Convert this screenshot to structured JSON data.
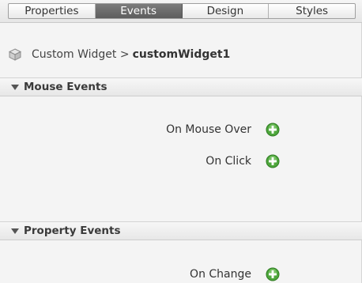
{
  "tabs": [
    {
      "label": "Properties",
      "active": false
    },
    {
      "label": "Events",
      "active": true
    },
    {
      "label": "Design",
      "active": false
    },
    {
      "label": "Styles",
      "active": false
    }
  ],
  "breadcrumb": {
    "parent": "Custom Widget >",
    "current": "customWidget1"
  },
  "sections": {
    "mouse": {
      "title": "Mouse Events",
      "events": [
        "On Mouse Over",
        "On Click"
      ]
    },
    "property": {
      "title": "Property Events",
      "events": [
        "On Change"
      ]
    }
  },
  "icons": {
    "add": "green-plus-icon",
    "widget": "cube-icon",
    "collapse": "triangle-down-icon"
  },
  "colors": {
    "active_tab": "#6a6a6a",
    "add_icon": "#3d9b2f"
  }
}
